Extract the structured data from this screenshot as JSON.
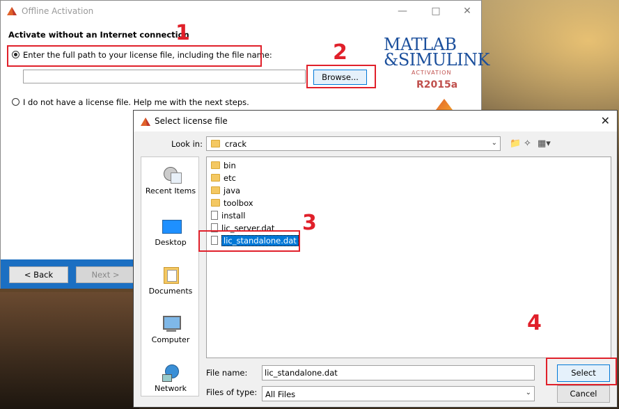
{
  "activation_window": {
    "title": "Offline Activation",
    "heading": "Activate without an Internet connection",
    "option_have_license": "Enter the full path to your license file, including the file name:",
    "option_no_license": "I do not have a license file.  Help me with the next steps.",
    "path_value": "",
    "browse_label": "Browse...",
    "back_label": "< Back",
    "next_label": "Next >",
    "logo": {
      "line1": "MATLAB",
      "line2": "&SIMULINK",
      "sub": "ACTIVATION",
      "version": "R2015a"
    }
  },
  "dialog": {
    "title": "Select license file",
    "look_in_label": "Look in:",
    "look_in_value": "crack",
    "places": [
      {
        "label": "Recent Items",
        "icon": "recent-items-icon"
      },
      {
        "label": "Desktop",
        "icon": "desktop-icon"
      },
      {
        "label": "Documents",
        "icon": "documents-icon"
      },
      {
        "label": "Computer",
        "icon": "computer-icon"
      },
      {
        "label": "Network",
        "icon": "network-icon"
      }
    ],
    "files": [
      {
        "name": "bin",
        "kind": "folder"
      },
      {
        "name": "etc",
        "kind": "folder"
      },
      {
        "name": "java",
        "kind": "folder"
      },
      {
        "name": "toolbox",
        "kind": "folder"
      },
      {
        "name": "install",
        "kind": "file"
      },
      {
        "name": "lic_server.dat",
        "kind": "file"
      },
      {
        "name": "lic_standalone.dat",
        "kind": "file",
        "selected": true
      }
    ],
    "file_name_label": "File name:",
    "file_name_value": "lic_standalone.dat",
    "file_type_label": "Files of type:",
    "file_type_value": "All Files",
    "select_label": "Select",
    "cancel_label": "Cancel"
  },
  "annotations": {
    "step1": "1",
    "step2": "2",
    "step3": "3",
    "step4": "4",
    "color": "#e0202a"
  }
}
